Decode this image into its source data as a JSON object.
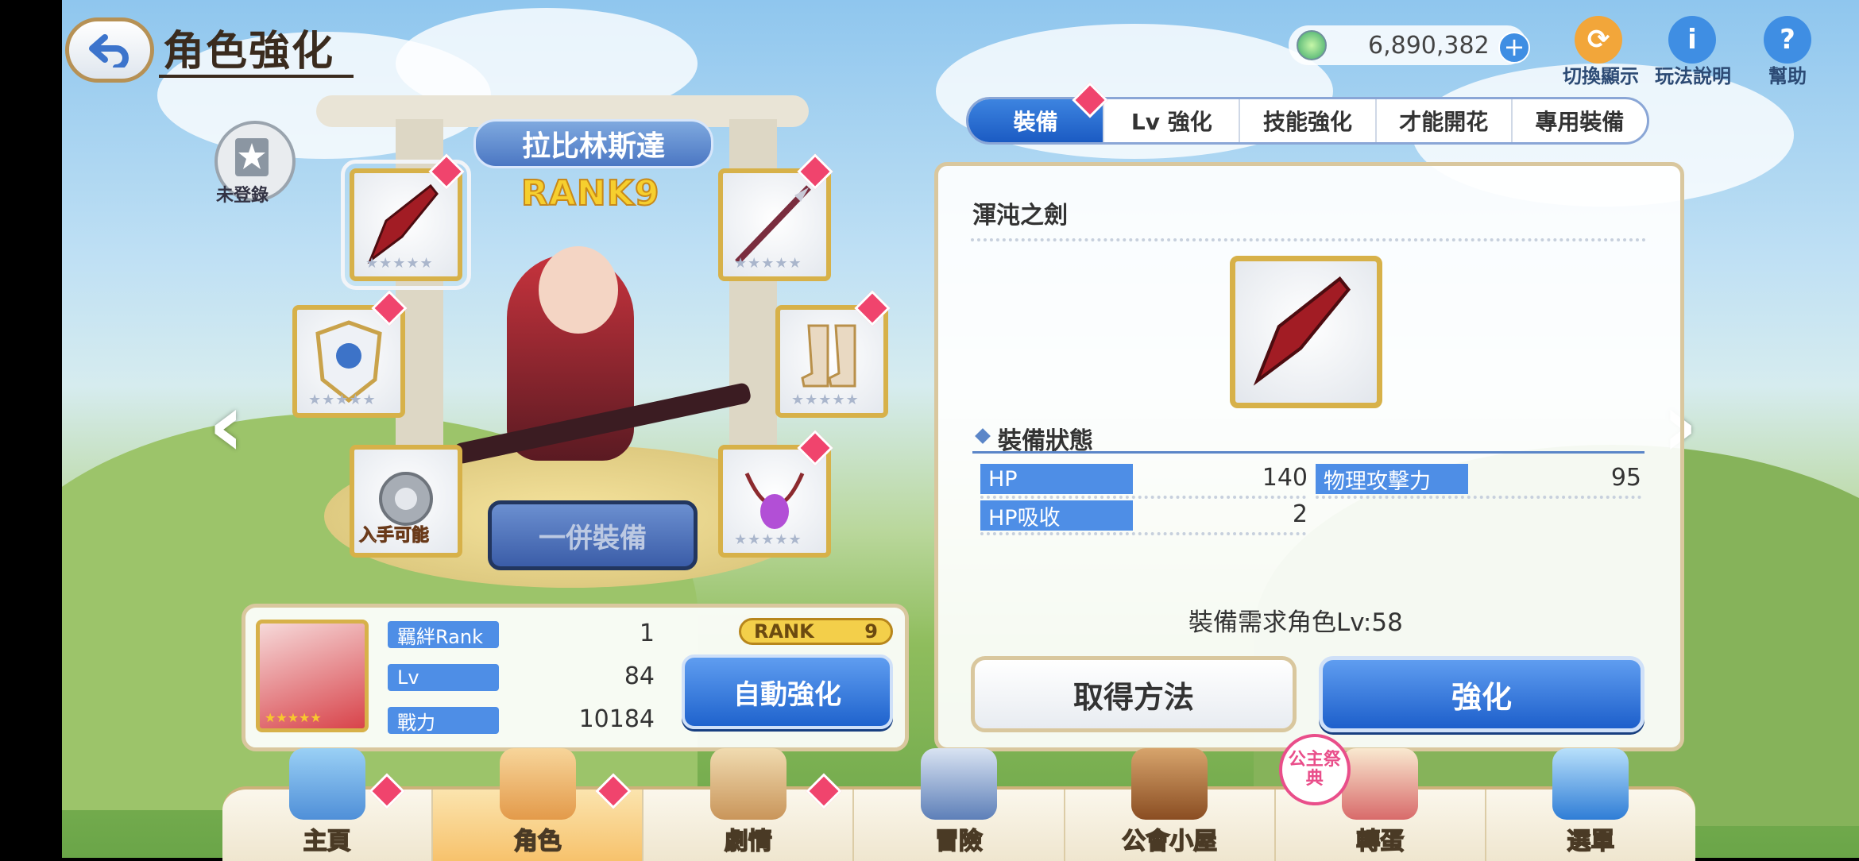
{
  "header": {
    "title": "角色強化",
    "currency_value": "6,890,382",
    "icons": [
      {
        "name": "switch-display-icon",
        "label": "切換顯示"
      },
      {
        "name": "info-icon",
        "label": "玩法說明"
      },
      {
        "name": "help-icon",
        "label": "幫助"
      }
    ]
  },
  "character": {
    "name": "拉比林斯達",
    "rank_text": "RANK9",
    "registration": "未登錄",
    "bond_label": "羈絆Rank",
    "bond_value": "1",
    "lv_label": "Lv",
    "lv_value": "84",
    "power_label": "戰力",
    "power_value": "10184",
    "rank_pill_label": "RANK",
    "rank_pill_value": "9",
    "star_count": 5,
    "equip_slots": [
      {
        "name": "sword",
        "badge": true,
        "selected": true
      },
      {
        "name": "spear",
        "badge": true
      },
      {
        "name": "shield",
        "badge": true
      },
      {
        "name": "boots",
        "badge": true
      },
      {
        "name": "chakram",
        "badge": false,
        "status": "入手可能"
      },
      {
        "name": "amulet",
        "badge": true
      }
    ],
    "bulk_equip_label": "一併裝備",
    "auto_enhance_label": "自動強化"
  },
  "tabs": [
    "裝備",
    "Lv 強化",
    "技能強化",
    "才能開花",
    "專用裝備"
  ],
  "equipment": {
    "name": "渾沌之劍",
    "status_title": "裝備狀態",
    "stats": [
      {
        "label": "HP",
        "value": "140"
      },
      {
        "label": "物理攻擊力",
        "value": "95"
      },
      {
        "label": "HP吸收",
        "value": "2"
      }
    ],
    "requirement": "裝備需求角色Lv:58",
    "obtain_label": "取得方法",
    "enhance_label": "強化"
  },
  "nav": [
    {
      "label": "主頁",
      "badge": true
    },
    {
      "label": "角色",
      "badge": true,
      "active": true
    },
    {
      "label": "劇情",
      "badge": true
    },
    {
      "label": "冒險",
      "badge": false
    },
    {
      "label": "公會小屋",
      "badge": false
    },
    {
      "label": "轉蛋",
      "badge": false,
      "tag": "公主祭典"
    },
    {
      "label": "選單",
      "badge": false
    }
  ],
  "colors": {
    "accent_blue": "#1f63cd",
    "badge_pink": "#f0446d",
    "gold_frame": "#d7b149"
  }
}
